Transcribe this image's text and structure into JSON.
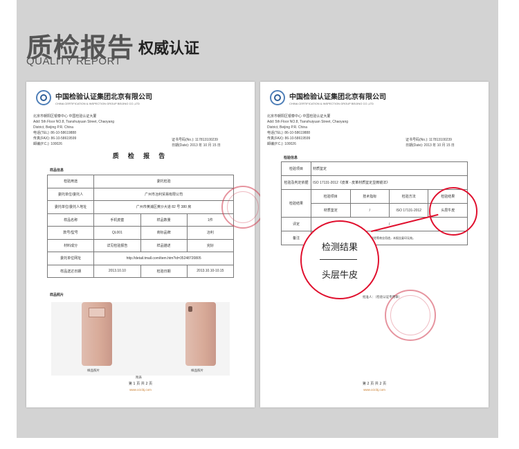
{
  "header": {
    "title_cn": "质检报告",
    "subtitle_cn": "权威认证",
    "title_en": "QUALITY REPORT"
  },
  "org": {
    "name": "中国检验认证集团北京有限公司",
    "name_en": "CHINA CERTIFICATION & INSPECTION GROUP BEIJING CO.,LTD",
    "address_lines": [
      "北京市朝阳区银泰中心 中国检验认证大厦",
      "Add: 5th Floor NO.8, Tianshuiyuan Street, Chaoyang",
      "District, Beijing P.R. China",
      "电话(TEL): 86-10-58619888",
      "传真(FAX): 86-10-58619599",
      "邮编(P.C.): 100026"
    ]
  },
  "page1": {
    "report_no": "证书号码(No.): 117813100239",
    "date": "日期(Date): 2013 年 10 月 15 日",
    "report_title": "质 检 报 告",
    "section_sample": "样品信息",
    "rows": [
      [
        "检验用途",
        "委托检验"
      ],
      [
        "委托单位/委托人",
        "广州市冶利贸易有限公司"
      ],
      [
        "委托单位/委托人地址",
        "广州市黄浦区黄沙大道 82 号 380 房"
      ]
    ],
    "grid": [
      [
        "样品名称",
        "手机皮套",
        "样品数量",
        "1件"
      ],
      [
        "款号/型号",
        "QL001",
        "商标品牌",
        "冶利"
      ],
      [
        "材料成分",
        "详见检验报告",
        "样品描述",
        "完好"
      ]
    ],
    "link_label": "委托单位网址",
    "link_value": "http://detail.tmall.com/item.htm?id=35248720805",
    "date_row": [
      "样品送达日期",
      "2013.10.10",
      "检验日期",
      "2013.10.10-10.15"
    ],
    "section_photo": "样品照片",
    "photo_cap1": "样品照片",
    "photo_cap2": "样品照片",
    "photo_note": "附表",
    "page_num": "第 1 页 共 2 页",
    "website": "www.ccicbj.com"
  },
  "page2": {
    "report_no": "证书号码(No.): 117813100239",
    "date": "日期(Date): 2013 年 10 月 15 日",
    "section": "检验信息",
    "r1": [
      "检验项目",
      "材质鉴定"
    ],
    "r2": [
      "检验及判定依据",
      "ISO 17131-2012《皮革 - 皮革材质鉴定显微镜法》"
    ],
    "sub_head": [
      "检验项目",
      "技术指标",
      "检验方法",
      "检验结果"
    ],
    "sub_row": [
      "材质鉴定",
      "/",
      "ISO 17131-2012",
      "头层牛皮"
    ],
    "r_result_label": "检验结果",
    "r_eval": [
      "评定",
      "/"
    ],
    "r_remark": [
      "备注",
      "本报告仅对来样负责，不得用于产品质量认证的检验等商业用途，本报告复印无效。"
    ],
    "magnified_t1": "检测结果",
    "magnified_t2": "头层牛皮",
    "seal_note": "批准人：（检验认证专用章）",
    "page_num": "第 2 页 共 2 页",
    "website": "www.ccicbj.com"
  }
}
